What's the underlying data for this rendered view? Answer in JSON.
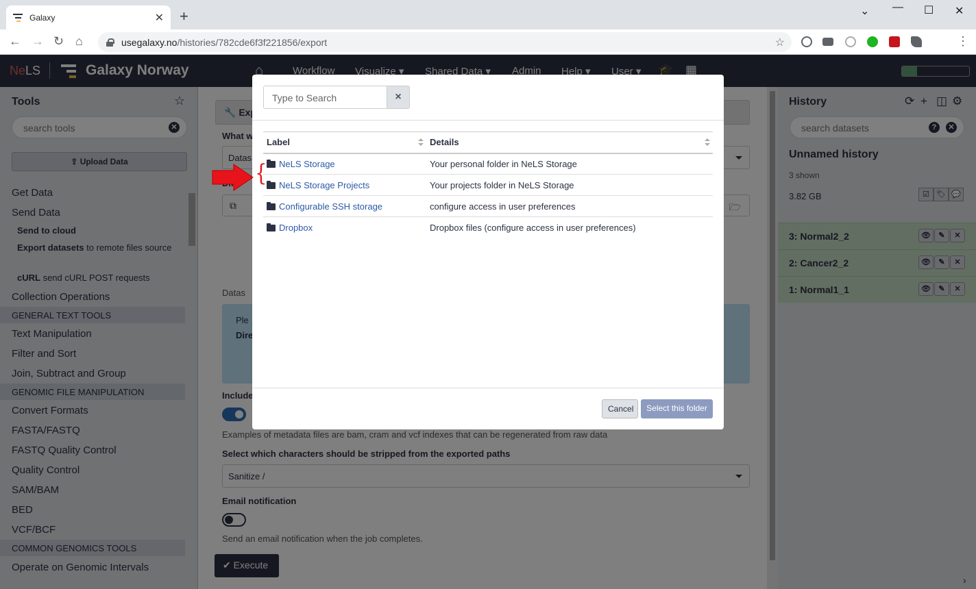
{
  "browser": {
    "tab_title": "Galaxy",
    "tab_close": "✕",
    "new_tab": "+",
    "url_domain": "usegalaxy.no",
    "url_path": "/histories/782cde6f3f221856/export"
  },
  "masthead": {
    "brand_prefix": "Ne",
    "brand_suffix": "LS",
    "title": "Galaxy Norway",
    "nav": [
      "Workflow",
      "Visualize ▾",
      "Shared Data ▾",
      "Admin",
      "Help ▾",
      "User ▾"
    ],
    "quota": {
      "label": "Using 22%",
      "percent": 22
    }
  },
  "tools": {
    "title": "Tools",
    "search_placeholder": "search tools",
    "upload_label": "Upload Data",
    "sections": [
      {
        "label": "Get Data"
      },
      {
        "label": "Send Data"
      }
    ],
    "send_items": [
      {
        "bold": "Send to cloud",
        "rest": ""
      },
      {
        "bold": "Export datasets",
        "rest": " to remote files source"
      },
      {
        "bold": "cURL",
        "rest": " send cURL POST requests"
      }
    ],
    "collection_ops": "Collection Operations",
    "cat_general": "GENERAL TEXT TOOLS",
    "general_items": [
      "Text Manipulation",
      "Filter and Sort",
      "Join, Subtract and Group"
    ],
    "cat_genomic": "GENOMIC FILE MANIPULATION",
    "genomic_items": [
      "Convert Formats",
      "FASTA/FASTQ",
      "FASTQ Quality Control",
      "Quality Control",
      "SAM/BAM",
      "BED",
      "VCF/BCF"
    ],
    "cat_common": "COMMON GENOMICS TOOLS",
    "common_items": [
      "Operate on Genomic Intervals"
    ]
  },
  "form": {
    "header": "Exp",
    "what_label": "What w",
    "dataset_select": "Datas",
    "directory_label": "Dire",
    "dataset_label": "Datas",
    "info_text": "Ple",
    "info_dir": "Dire",
    "include_label": "Include",
    "metadata_help": "Examples of metadata files are bam, cram and vcf indexes that can be regenerated from raw data",
    "strip_label": "Select which characters should be stripped from the exported paths",
    "strip_value": "Sanitize /",
    "email_label": "Email notification",
    "email_help": "Send an email notification when the job completes.",
    "execute_label": "Execute"
  },
  "history": {
    "title": "History",
    "search_placeholder": "search datasets",
    "name": "Unnamed history",
    "shown": "3 shown",
    "size": "3.82 GB",
    "items": [
      {
        "label": "3: Normal2_2"
      },
      {
        "label": "2: Cancer2_2"
      },
      {
        "label": "1: Normal1_1"
      }
    ]
  },
  "modal": {
    "search_placeholder": "Type to Search",
    "col_label": "Label",
    "col_details": "Details",
    "rows": [
      {
        "label": "NeLS Storage",
        "details": "Your personal folder in NeLS Storage"
      },
      {
        "label": "NeLS Storage Projects",
        "details": "Your projects folder in NeLS Storage"
      },
      {
        "label": "Configurable SSH storage",
        "details": "configure access in user preferences"
      },
      {
        "label": "Dropbox",
        "details": "Dropbox files (configure access in user preferences)"
      }
    ],
    "cancel_label": "Cancel",
    "select_label": "Select this folder"
  },
  "annotation": {
    "brace": "{",
    "arrow_color": "#e8141b"
  }
}
